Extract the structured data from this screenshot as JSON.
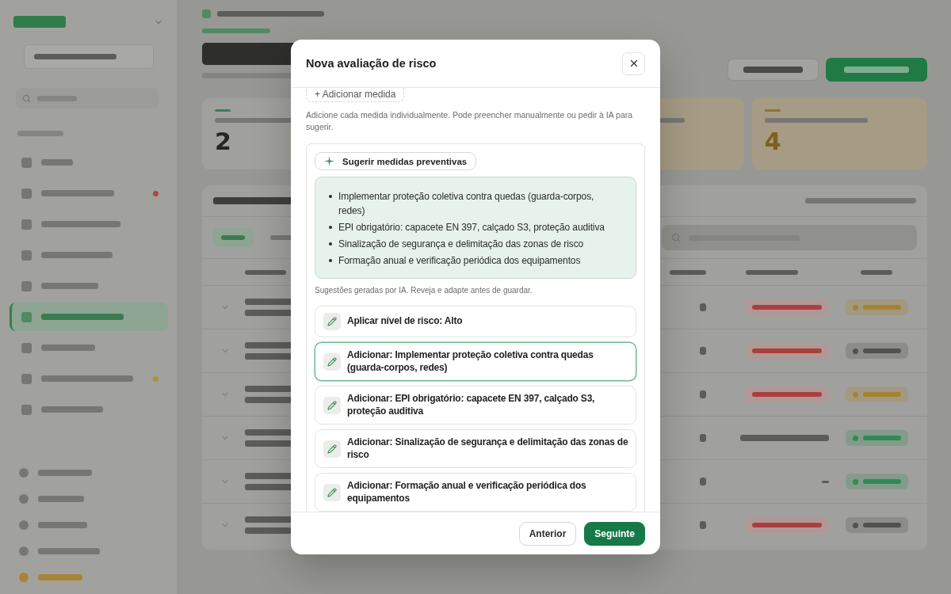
{
  "backdrop": {
    "nav_rows": [
      {
        "selected": false
      },
      {
        "selected": false,
        "color": "#b8443c"
      },
      {
        "selected": false
      },
      {
        "selected": false
      },
      {
        "selected": false
      },
      {
        "selected": true
      },
      {
        "selected": false
      },
      {
        "selected": false,
        "color": "#b0903a"
      },
      {
        "selected": false
      }
    ],
    "bottom_rows": [
      {
        "kind": "plain"
      },
      {
        "kind": "plain"
      },
      {
        "kind": "plain"
      },
      {
        "kind": "plain"
      },
      {
        "kind": "accent"
      }
    ],
    "stats": [
      {
        "kind": "neutral",
        "value": "2"
      },
      {
        "kind": "warning"
      },
      {
        "kind": "warning",
        "value": "4"
      }
    ],
    "tabs": [
      {
        "selected": true
      },
      {
        "selected": false
      }
    ],
    "rows": [
      {
        "kind": "overdue",
        "color": "#a68230"
      },
      {
        "kind": "overdue",
        "color": "#4f524e"
      },
      {
        "kind": "overdue",
        "color": "#a68230"
      },
      {
        "kind": "dated",
        "color": "#2f8a55"
      },
      {
        "kind": "undated",
        "color": "#2f8a55"
      },
      {
        "kind": "overdue",
        "color": "#4f524e"
      }
    ]
  },
  "modal": {
    "title": "Nova avaliação de risco",
    "add_button": "+ Adicionar medida",
    "hint": "Adicione cada medida individualmente. Pode preencher manualmente ou pedir à IA para sugerir.",
    "suggest_button": "Sugerir medidas preventivas",
    "suggestions": [
      "Implementar proteção coletiva contra quedas (guarda-corpos, redes)",
      "EPI obrigatório: capacete EN 397, calçado S3, proteção auditiva",
      "Sinalização de segurança e delimitação das zonas de risco",
      "Formação anual e verificação periódica dos equipamentos"
    ],
    "ai_note": "Sugestões geradas por IA. Reveja e adapte antes de guardar.",
    "actions": [
      {
        "label": "Aplicar nível de risco: Alto",
        "selected": false
      },
      {
        "label": "Adicionar: Implementar proteção coletiva contra quedas (guarda-corpos, redes)",
        "selected": true
      },
      {
        "label": "Adicionar: EPI obrigatório: capacete EN 397, calçado S3, proteção auditiva",
        "selected": false
      },
      {
        "label": "Adicionar: Sinalização de segurança e delimitação das zonas de risco",
        "selected": false
      },
      {
        "label": "Adicionar: Formação anual e verificação periódica dos equipamentos",
        "selected": false
      }
    ],
    "buttons": [
      {
        "label": "Anterior",
        "kind": "secondary"
      },
      {
        "label": "Seguinte",
        "kind": "primary"
      }
    ]
  }
}
